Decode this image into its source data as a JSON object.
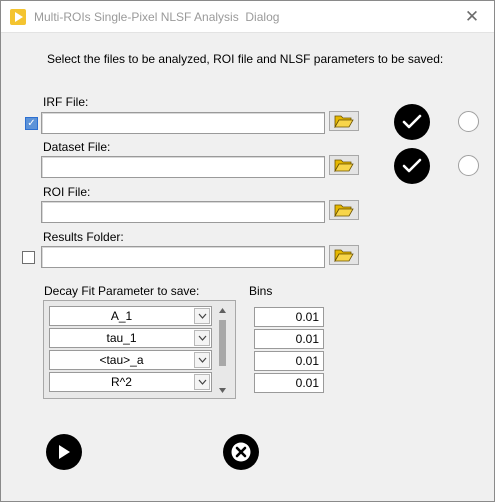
{
  "window": {
    "title": "Multi-ROIs Single-Pixel NLSF Analysis  Dialog",
    "close_glyph": "✕"
  },
  "instruction": "Select the files to be analyzed, ROI file and NLSF parameters to be saved:",
  "fields": {
    "irf": {
      "label": "IRF File:",
      "value": "",
      "checked": true
    },
    "dataset": {
      "label": "Dataset File:",
      "value": ""
    },
    "roi": {
      "label": "ROI File:",
      "value": ""
    },
    "results": {
      "label": "Results Folder:",
      "value": "",
      "checked": false
    }
  },
  "params": {
    "label": "Decay Fit Parameter to save:",
    "items": [
      "A_1",
      "tau_1",
      "<tau>_a",
      "R^2"
    ]
  },
  "bins": {
    "label": "Bins",
    "values": [
      "0.01",
      "0.01",
      "0.01",
      "0.01"
    ]
  },
  "icons": {
    "app": "play-icon",
    "browse": "folder-open-icon",
    "confirm": "check-icon",
    "run": "play-icon",
    "cancel": "cancel-icon"
  },
  "colors": {
    "app_icon": "#f4c430",
    "checkbox_fill": "#5d93d8",
    "button_fill": "#000000"
  }
}
